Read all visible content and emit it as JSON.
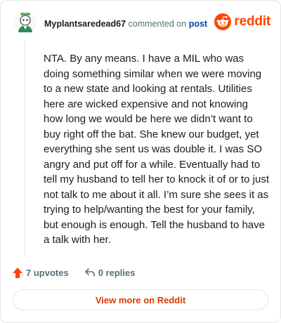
{
  "comment": {
    "username": "Myplantsaredead67",
    "action_text": "commented on",
    "post_link": "post",
    "body": "NTA. By any means. I have a MIL who was doing something similar when we were moving to a new state and looking at rentals. Utilities here are wicked expensive and not knowing how long we would be here we didn’t want to buy right off the bat. She knew our budget, yet everything she sent us was double it. I was SO angry and put off for a while. Eventually had to tell my husband to tell her to knock it of or to just not talk to me about it all. I’m sure she sees it as trying to help/wanting the best for your family, but enough is enough. Tell the husband to have a talk with her."
  },
  "brand": {
    "name": "reddit",
    "icon": "reddit-logo-icon",
    "color": "#ff4500"
  },
  "actions": {
    "upvotes": "7 upvotes",
    "upvote_icon": "upvote-arrow-icon",
    "replies": "0 replies",
    "reply_icon": "reply-arrow-icon"
  },
  "footer": {
    "view_more_label": "View more on Reddit"
  }
}
